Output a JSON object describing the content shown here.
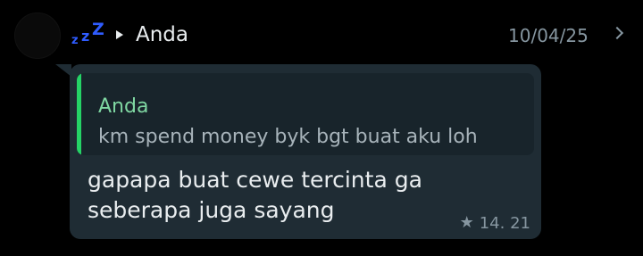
{
  "header": {
    "avatar_icon": "avatar-placeholder",
    "status_icon": "sleep-zzz-icon",
    "status_color": "#2f5cff",
    "arrow_icon": "forward-arrow-icon",
    "sender": "Anda",
    "date": "10/04/25",
    "chevron_icon": "chevron-right-icon"
  },
  "quote": {
    "name": "Anda",
    "text": "km spend money byk bgt buat aku loh",
    "accent_color": "#25d366"
  },
  "message": {
    "text": "gapapa buat cewe tercinta ga\nseberapa juga sayang",
    "star_icon": "star-icon",
    "time": "14. 21"
  }
}
